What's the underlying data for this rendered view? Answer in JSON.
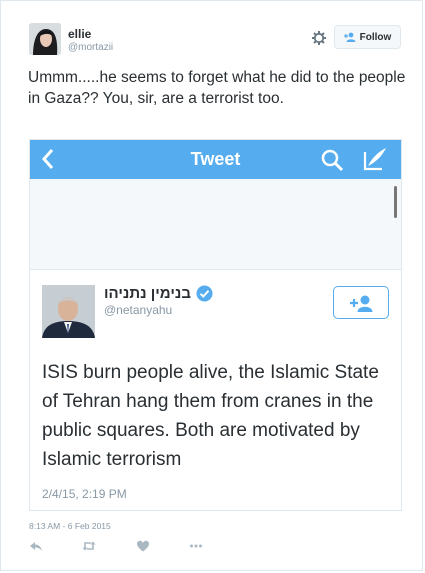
{
  "tweet": {
    "user": {
      "name": "ellie",
      "handle": "@mortazii"
    },
    "follow_label": "Follow",
    "text": "Ummm.....he seems to forget what he did to the people in Gaza?? You, sir, are a terrorist too.",
    "timestamp": "8:13 AM - 6 Feb 2015",
    "icons": [
      "gear-icon",
      "follow-user-icon",
      "reply-icon",
      "retweet-icon",
      "favorite-icon",
      "more-icon"
    ]
  },
  "embedded": {
    "header_title": "Tweet",
    "icons": [
      "back-icon",
      "search-icon",
      "compose-icon"
    ],
    "author": {
      "name": "בנימין נתניהו",
      "handle": "@netanyahu",
      "verified": true
    },
    "text": "ISIS burn people alive, the Islamic State of Tehran hang them from cranes in the public squares. Both are motivated by Islamic terrorism",
    "timestamp": "2/4/15, 2:19 PM",
    "colors": {
      "bar": "#55acee",
      "accent": "#55acee"
    }
  }
}
